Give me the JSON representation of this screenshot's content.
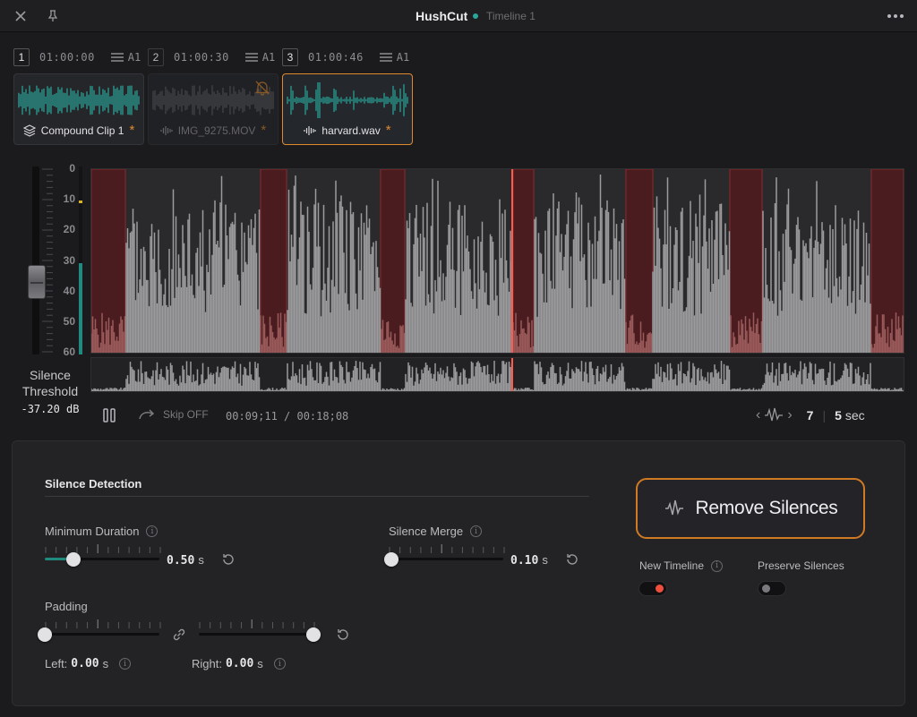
{
  "app": {
    "title": "HushCut",
    "timeline": "Timeline 1"
  },
  "clips": [
    {
      "index": "1",
      "timecode": "01:00:00",
      "track": "A1",
      "name": "Compound Clip 1",
      "modified": "*",
      "state": "normal"
    },
    {
      "index": "2",
      "timecode": "01:00:30",
      "track": "A1",
      "name": "IMG_9275.MOV",
      "modified": "*",
      "state": "disabled"
    },
    {
      "index": "3",
      "timecode": "01:00:46",
      "track": "A1",
      "name": "harvard.wav",
      "modified": "*",
      "state": "selected"
    }
  ],
  "meter": {
    "ticks": [
      "0",
      "10",
      "20",
      "30",
      "40",
      "50",
      "60"
    ]
  },
  "threshold": {
    "label_line1": "Silence",
    "label_line2": "Threshold",
    "value": "-37.20 dB"
  },
  "transport": {
    "skip_label": "Skip OFF",
    "timecode": "00:09;11 / 00:18;08",
    "silence_count": "7",
    "window_value": "5",
    "window_unit": "sec"
  },
  "settings": {
    "section_title": "Silence Detection",
    "min_duration": {
      "label": "Minimum Duration",
      "value": "0.50",
      "unit": "s",
      "fraction": 0.25
    },
    "silence_merge": {
      "label": "Silence Merge",
      "value": "0.10",
      "unit": "s",
      "fraction": 0.02
    },
    "padding": {
      "label": "Padding",
      "left_label": "Left:",
      "left_value": "0.00",
      "left_unit": "s",
      "right_label": "Right:",
      "right_value": "0.00",
      "right_unit": "s"
    }
  },
  "actions": {
    "remove_label": "Remove Silences",
    "new_timeline_label": "New Timeline",
    "new_timeline_on": true,
    "preserve_label": "Preserve Silences",
    "preserve_on": false
  },
  "colors": {
    "accent": "#2aa79b",
    "highlight": "#e08a2d",
    "silence": "#5a1f22",
    "playhead": "#ff5a4a"
  }
}
